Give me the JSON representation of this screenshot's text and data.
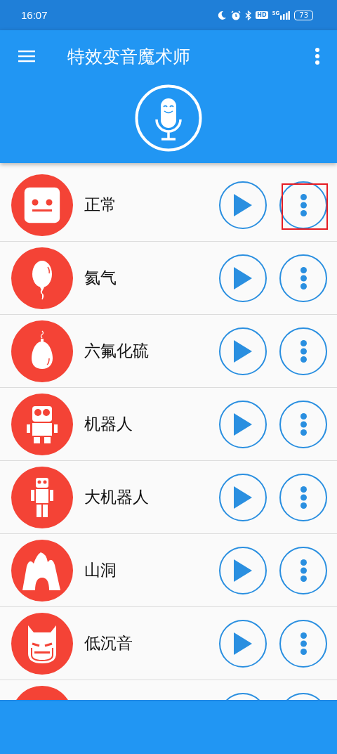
{
  "status_bar": {
    "time": "16:07",
    "hd": "HD",
    "network": "5G",
    "battery": "73"
  },
  "app_bar": {
    "title": "特效变音魔术师"
  },
  "effects": [
    {
      "label": "正常",
      "kind": "face",
      "highlighted": true
    },
    {
      "label": "氦气",
      "kind": "balloon",
      "highlighted": false
    },
    {
      "label": "六氟化硫",
      "kind": "weight",
      "highlighted": false
    },
    {
      "label": "机器人",
      "kind": "robot",
      "highlighted": false
    },
    {
      "label": "大机器人",
      "kind": "giant",
      "highlighted": false
    },
    {
      "label": "山洞",
      "kind": "cave",
      "highlighted": false
    },
    {
      "label": "低沉音",
      "kind": "mask",
      "highlighted": false
    },
    {
      "kind": "partial",
      "highlighted": false
    }
  ]
}
